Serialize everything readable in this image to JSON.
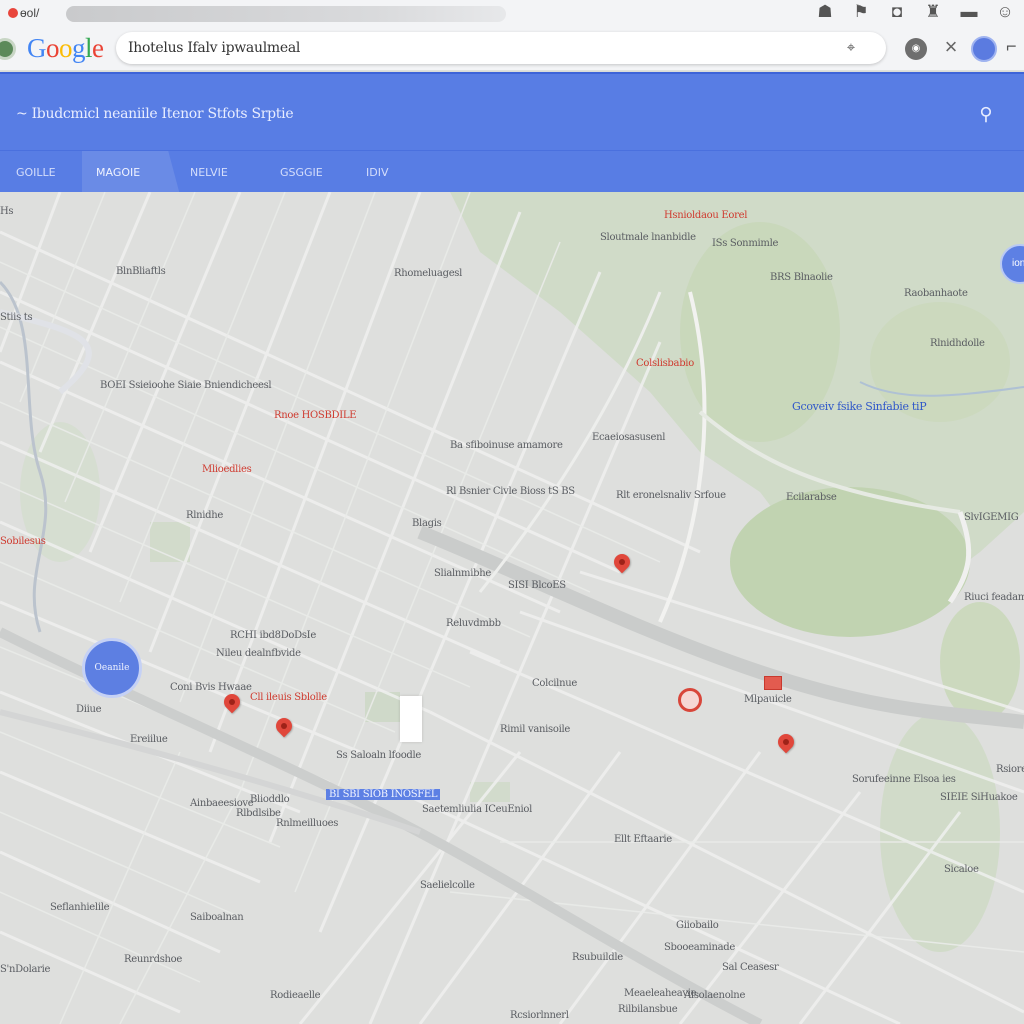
{
  "browser": {
    "tab_title": "ɵol/",
    "top_icons": [
      "account-icon",
      "bookmark-icon",
      "chat-icon",
      "extension-icon",
      "cast-icon",
      "profile-icon"
    ]
  },
  "header": {
    "logo": "Google",
    "search_value": "Ihotelus Ifalv   ipwaulmeal",
    "mic_label": "◉"
  },
  "panel": {
    "title": "~ Ibudcmicl neaniile Itenor Stfots Srptie",
    "tabs": [
      {
        "label": "GOILLE"
      },
      {
        "label": "MAGOIE"
      },
      {
        "label": "NELVIE"
      },
      {
        "label": "GSGGIE"
      },
      {
        "label": "IDIV"
      }
    ],
    "active_tab_index": 1
  },
  "map": {
    "user_location_label": "Oeanile",
    "right_fab_label": "ion",
    "labels": [
      {
        "text": "Hs",
        "cls": ""
      },
      {
        "text": "Hsnioldaou Eorel",
        "cls": "red"
      },
      {
        "text": "Sloutmale lnanbidle",
        "cls": ""
      },
      {
        "text": "ISs Sonmimle",
        "cls": ""
      },
      {
        "text": "BRS Blnaolie",
        "cls": ""
      },
      {
        "text": "BlnBliaftls",
        "cls": ""
      },
      {
        "text": "Rhomeluagesl",
        "cls": ""
      },
      {
        "text": "Raobanhaote",
        "cls": ""
      },
      {
        "text": "Stiis ts",
        "cls": ""
      },
      {
        "text": "Rlnidhdolle",
        "cls": ""
      },
      {
        "text": "Colslisbabio",
        "cls": "red"
      },
      {
        "text": "Ecaeiosasusenl",
        "cls": ""
      },
      {
        "text": "Gcoveiv fsike Sinfabie tiP",
        "cls": "blue"
      },
      {
        "text": "BOEI Ssieioohe Siaie Bniendicheesl",
        "cls": ""
      },
      {
        "text": "Rnoe HOSBDILE",
        "cls": "red"
      },
      {
        "text": "Ba sfiboinuse amamore",
        "cls": ""
      },
      {
        "text": "Mlioedlies",
        "cls": "red"
      },
      {
        "text": "Rlnidhe",
        "cls": ""
      },
      {
        "text": "Rl Bsnier Civle Bioss tS BS",
        "cls": ""
      },
      {
        "text": "Rlt eronelsnaliv Srfoue",
        "cls": ""
      },
      {
        "text": "Ecilarabse",
        "cls": ""
      },
      {
        "text": "SlvIGEMIG",
        "cls": ""
      },
      {
        "text": "Blagis",
        "cls": ""
      },
      {
        "text": "Sobilesus",
        "cls": "red"
      },
      {
        "text": "SISI BlcoES",
        "cls": ""
      },
      {
        "text": "Slialnmibhe",
        "cls": ""
      },
      {
        "text": "RCHI ibd8DoDsIe",
        "cls": ""
      },
      {
        "text": "Nileu dealnfbvide",
        "cls": ""
      },
      {
        "text": "Reluvdmbb",
        "cls": ""
      },
      {
        "text": "Riuci feadamleeve",
        "cls": ""
      },
      {
        "text": "Coni Bvis Hwaae",
        "cls": ""
      },
      {
        "text": "Cll ileuis Sblolle",
        "cls": "red"
      },
      {
        "text": "Diiue",
        "cls": ""
      },
      {
        "text": "Ereiilue",
        "cls": ""
      },
      {
        "text": "Rimil vanisoile",
        "cls": ""
      },
      {
        "text": "Colcilnue",
        "cls": ""
      },
      {
        "text": "Mlpauicle",
        "cls": ""
      },
      {
        "text": "Ss Saloaln lfoodle",
        "cls": ""
      },
      {
        "text": "Saetemliulia ICeuEniol",
        "cls": ""
      },
      {
        "text": "Rnlmeilluoes",
        "cls": ""
      },
      {
        "text": "Ellt Eftaarie",
        "cls": ""
      },
      {
        "text": "Ainbaeesiove",
        "cls": ""
      },
      {
        "text": "Rlbdlsibe",
        "cls": ""
      },
      {
        "text": "SIEIE SiHuakoe",
        "cls": ""
      },
      {
        "text": "Sorufeeinne Elsoa ies",
        "cls": ""
      },
      {
        "text": "Seflanhielile",
        "cls": ""
      },
      {
        "text": "Saiboalnan",
        "cls": ""
      },
      {
        "text": "Rodieaelle",
        "cls": ""
      },
      {
        "text": "Rsubuildle",
        "cls": ""
      },
      {
        "text": "Sbooeaminade",
        "cls": ""
      },
      {
        "text": "Meaeleaheavie",
        "cls": ""
      },
      {
        "text": "Rcsiorlnnerl",
        "cls": ""
      },
      {
        "text": "Sal Ceasesr",
        "cls": ""
      },
      {
        "text": "Giiobailo",
        "cls": ""
      },
      {
        "text": "Saelielcolle",
        "cls": ""
      },
      {
        "text": "Rilbilansbue",
        "cls": ""
      },
      {
        "text": "Alsolaenolne",
        "cls": ""
      },
      {
        "text": "Blioddlo",
        "cls": ""
      },
      {
        "text": "Reunrdshoe",
        "cls": ""
      },
      {
        "text": "S'nDolarie",
        "cls": ""
      },
      {
        "text": "Sicaloe",
        "cls": ""
      },
      {
        "text": "Rsiore",
        "cls": ""
      }
    ],
    "highlighted_label": "BI SBI SIOB INOSFEL"
  }
}
